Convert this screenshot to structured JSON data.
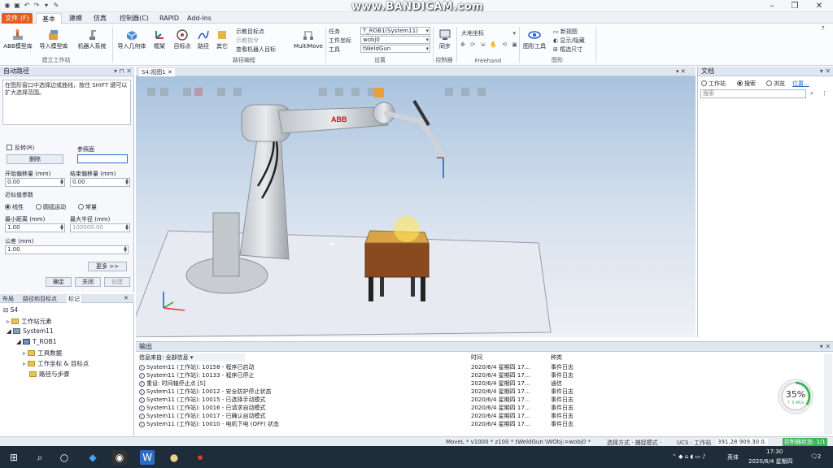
{
  "titlebar": {
    "watermark": "www.BANDICAM.com",
    "behind_title": "NJ/RS"
  },
  "tabs": [
    "文件 (F)",
    "基本",
    "建模",
    "仿真",
    "控制器(C)",
    "RAPID",
    "Add-Ins"
  ],
  "ribbon": {
    "buttons": [
      "ABB模型库",
      "导入模型库",
      "机器人系统",
      "导入几何体",
      "框架",
      "目标点",
      "路径",
      "其它",
      "MultiMove",
      "同步",
      "图形工具"
    ],
    "path_small": [
      "示教目标点",
      "示教指令",
      "查看机器人目标"
    ],
    "groups": [
      "建立工作站",
      "路径编程",
      "设置",
      "控制器",
      "Freehand",
      "图形"
    ],
    "settings_labels": [
      "任务",
      "工件坐标",
      "工具"
    ],
    "settings_values": [
      "T_ROB1(System11)",
      "wobj0",
      "tWeldGun"
    ],
    "freehand_value": "大地坐标",
    "graphics_items": [
      "新视图",
      "显示/隐藏",
      "框选尺寸"
    ]
  },
  "left_panel": {
    "title": "自动路径",
    "hint": "在图形窗口中选择边或曲线，按住 SHIFT 键可以扩大选择范围。",
    "reverse_label": "反转(R)",
    "ref_surface_label": "参照面",
    "delete_label": "删除",
    "start_offset_label": "开始偏移量 (mm)",
    "start_offset_value": "0.00",
    "end_offset_label": "结束偏移量 (mm)",
    "end_offset_value": "0.00",
    "approx_label": "近似值参数",
    "radio_options": [
      "线性",
      "圆弧运动",
      "常量"
    ],
    "min_dist_label": "最小距离 (mm)",
    "min_dist_value": "1.00",
    "max_radius_label": "最大半径 (mm)",
    "max_radius_value": "100000.00",
    "tolerance_label": "公差 (mm)",
    "tolerance_value": "1.00",
    "more_label": "更多 >>",
    "apply_label": "确定",
    "close_label": "关闭",
    "create_label": "创建"
  },
  "tree": {
    "tabs": [
      "布局",
      "路径和目标点",
      "标记"
    ],
    "items": [
      "S4",
      "工作站元素",
      "System11",
      "T_ROB1",
      "工具数据",
      "工作坐标 & 目标点",
      "路径与步骤"
    ]
  },
  "viewport": {
    "tab_label": "S4:视图1",
    "logo": "ABB"
  },
  "right_panel": {
    "title": "文档",
    "radios": [
      "工作站",
      "搜索",
      "浏览"
    ],
    "link": "位置...",
    "search_placeholder": "搜索"
  },
  "output": {
    "title": "输出",
    "filter_label": "信息来自: 全部信息",
    "col_time": "时间",
    "col_type": "种类",
    "rows": [
      {
        "msg": "System11 (工作站): 10158 - 程序已启动",
        "time": "2020/6/4 星期四 17...",
        "type": "事件日志"
      },
      {
        "msg": "System11 (工作站): 10133 - 程序已停止",
        "time": "2020/6/4 星期四 17...",
        "type": "事件日志"
      },
      {
        "msg": "重设: 时间轴停止点 [S]",
        "time": "2020/6/4 星期四 17...",
        "type": "通信"
      },
      {
        "msg": "System11 (工作站): 10012 - 安全防护停止状态",
        "time": "2020/6/4 星期四 17...",
        "type": "事件日志"
      },
      {
        "msg": "System11 (工作站): 10015 - 已选择手动模式",
        "time": "2020/6/4 星期四 17...",
        "type": "事件日志"
      },
      {
        "msg": "System11 (工作站): 10016 - 已请求自动模式",
        "time": "2020/6/4 星期四 17...",
        "type": "事件日志"
      },
      {
        "msg": "System11 (工作站): 10017 - 已确认自动模式",
        "time": "2020/6/4 星期四 17...",
        "type": "事件日志"
      },
      {
        "msg": "System11 (工作站): 10010 - 电机下电 (OFF) 状态",
        "time": "2020/6/4 星期四 17...",
        "type": "事件日志"
      }
    ]
  },
  "statusbar": {
    "left": "MoveL * v1000 * z100 * tWeldGun \\WObj:=wobj0 *",
    "select_mode": "选择方式 · 捕捉模式 ·",
    "ucs": "UCS : 工作站",
    "coords": "391.28  909.30  0.",
    "controller_status": "控制器状态: 1/1"
  },
  "overlay": {
    "percent": "35%",
    "speed": "↑ 3.4K/s"
  },
  "taskbar": {
    "time": "17:30",
    "date": "2020/6/4 星期四",
    "ime": "英体",
    "notif_count": "2"
  },
  "colors": {
    "file_tab": "#e35d1c",
    "floor": "#e7eaf0",
    "table_top": "#8a6a2e",
    "accent": "#2b6cc4"
  }
}
